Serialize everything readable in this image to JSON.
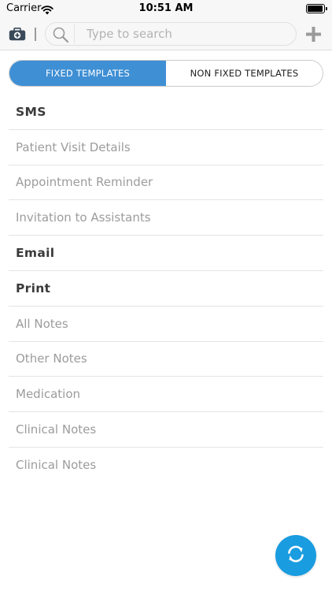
{
  "status_bar": {
    "carrier": "Carrier",
    "time": "10:51 AM",
    "battery_level": 0.95
  },
  "search": {
    "placeholder": "Type to search",
    "value": ""
  },
  "icons": {
    "kit": "medical-kit-icon",
    "search": "search-icon",
    "add": "plus-icon",
    "sync": "sync-icon"
  },
  "colors": {
    "accent": "#3f8fd4",
    "fab": "#1a9ce0",
    "muted_text": "#9c9c9c"
  },
  "tabs": [
    {
      "label": "FIXED TEMPLATES",
      "active": true
    },
    {
      "label": "NON FIXED TEMPLATES",
      "active": false
    }
  ],
  "list": [
    {
      "label": "SMS",
      "kind": "header"
    },
    {
      "label": "Patient Visit Details",
      "kind": "item"
    },
    {
      "label": "Appointment Reminder",
      "kind": "item"
    },
    {
      "label": "Invitation to Assistants",
      "kind": "item"
    },
    {
      "label": "Email",
      "kind": "header"
    },
    {
      "label": "Print",
      "kind": "header"
    },
    {
      "label": "All Notes",
      "kind": "item"
    },
    {
      "label": "Other Notes",
      "kind": "item"
    },
    {
      "label": "Medication",
      "kind": "item"
    },
    {
      "label": "Clinical Notes",
      "kind": "item"
    },
    {
      "label": "Clinical Notes",
      "kind": "item"
    }
  ]
}
